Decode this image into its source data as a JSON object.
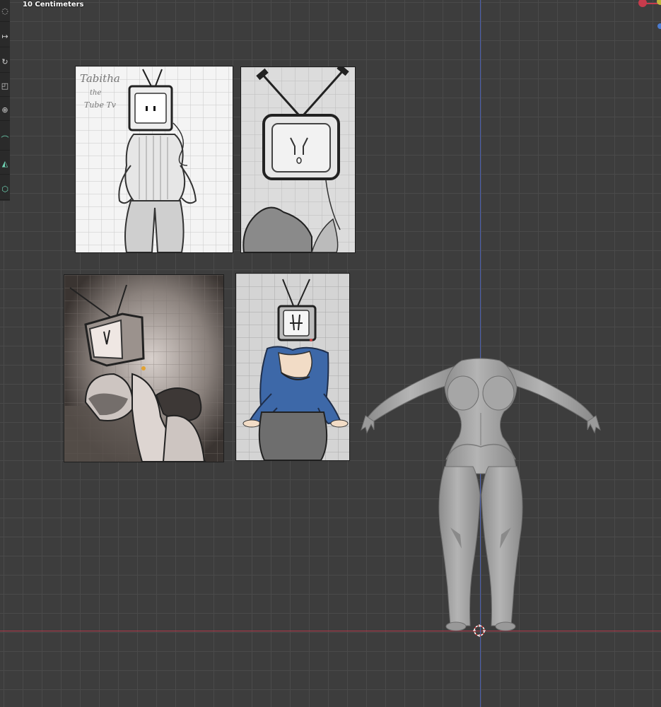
{
  "viewport": {
    "scale_label": "10 Centimeters",
    "background": "#3d3d3d",
    "grid_color": "#4a4a4a",
    "x_axis_color": "#b3384a",
    "y_axis_color": "#4a5fb0"
  },
  "toolbar": {
    "tools": [
      {
        "name": "select-box-icon",
        "glyph": "◌"
      },
      {
        "name": "move-icon",
        "glyph": "↦"
      },
      {
        "name": "rotate-icon",
        "glyph": "↻"
      },
      {
        "name": "scale-icon",
        "glyph": "◰"
      },
      {
        "name": "transform-icon",
        "glyph": "⊕"
      },
      {
        "name": "annotate-icon",
        "glyph": "⌒"
      },
      {
        "name": "measure-icon",
        "glyph": "◭"
      },
      {
        "name": "add-cube-icon",
        "glyph": "⬡"
      }
    ]
  },
  "reference_images": {
    "sketch_signature": [
      "Tabitha",
      "the",
      "Tube Tv"
    ]
  },
  "colors": {
    "sweater_blue": "#3d68a8",
    "model_gray": "#a8a8a8",
    "paper": "#f4f4f4"
  }
}
